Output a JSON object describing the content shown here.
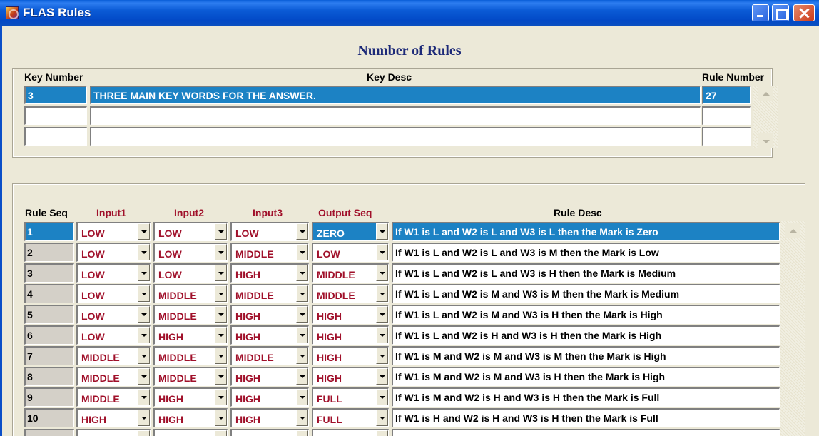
{
  "window": {
    "title": "FLAS Rules"
  },
  "rules_count": {
    "section_title": "Number of Rules",
    "headers": {
      "key_number": "Key Number",
      "key_desc": "Key Desc",
      "rule_number": "Rule Number"
    },
    "rows": [
      {
        "key_number": "3",
        "key_desc": "THREE MAIN KEY WORDS FOR THE ANSWER.",
        "rule_number": "27"
      },
      {
        "key_number": "",
        "key_desc": "",
        "rule_number": ""
      },
      {
        "key_number": "",
        "key_desc": "",
        "rule_number": ""
      }
    ],
    "selected_row": 0
  },
  "rules_grid": {
    "headers": {
      "rule_seq": "Rule Seq",
      "input1": "Input1",
      "input2": "Input2",
      "input3": "Input3",
      "output_seq": "Output Seq",
      "rule_desc": "Rule Desc"
    },
    "selected_row": 0,
    "rows": [
      {
        "seq": "1",
        "input1": "LOW",
        "input2": "LOW",
        "input3": "LOW",
        "output": "ZERO",
        "desc": "If W1 is L and W2 is L and W3 is L then the Mark is Zero"
      },
      {
        "seq": "2",
        "input1": "LOW",
        "input2": "LOW",
        "input3": "MIDDLE",
        "output": "LOW",
        "desc": "If W1 is L and W2 is L and W3 is M then the Mark is Low"
      },
      {
        "seq": "3",
        "input1": "LOW",
        "input2": "LOW",
        "input3": "HIGH",
        "output": "MIDDLE",
        "desc": "If W1 is L and W2 is L and W3 is H then the Mark is Medium"
      },
      {
        "seq": "4",
        "input1": "LOW",
        "input2": "MIDDLE",
        "input3": "MIDDLE",
        "output": "MIDDLE",
        "desc": "If W1 is L and W2 is M and W3 is M then the Mark is Medium"
      },
      {
        "seq": "5",
        "input1": "LOW",
        "input2": "MIDDLE",
        "input3": "HIGH",
        "output": "HIGH",
        "desc": "If W1 is L and W2 is M and W3 is H then the Mark is High"
      },
      {
        "seq": "6",
        "input1": "LOW",
        "input2": "HIGH",
        "input3": "HIGH",
        "output": "HIGH",
        "desc": "If W1 is L and W2 is H and W3 is H then the Mark is High"
      },
      {
        "seq": "7",
        "input1": "MIDDLE",
        "input2": "MIDDLE",
        "input3": "MIDDLE",
        "output": "HIGH",
        "desc": "If W1 is M and W2 is M and W3 is M then the Mark is High"
      },
      {
        "seq": "8",
        "input1": "MIDDLE",
        "input2": "MIDDLE",
        "input3": "HIGH",
        "output": "HIGH",
        "desc": "If W1 is M and W2 is M and W3 is H then the Mark is High"
      },
      {
        "seq": "9",
        "input1": "MIDDLE",
        "input2": "HIGH",
        "input3": "HIGH",
        "output": "FULL",
        "desc": "If W1 is M and W2 is H and W3 is H then the Mark is Full"
      },
      {
        "seq": "10",
        "input1": "HIGH",
        "input2": "HIGH",
        "input3": "HIGH",
        "output": "FULL",
        "desc": "If W1 is H and W2 is H and W3 is H then the Mark is Full"
      },
      {
        "seq": "",
        "input1": "",
        "input2": "",
        "input3": "",
        "output": "",
        "desc": ""
      }
    ]
  },
  "colors": {
    "selection": "#1c82c4",
    "header_red": "#a0102a",
    "section_title": "#1d2a78",
    "titlebar": "#0b5bd6"
  }
}
